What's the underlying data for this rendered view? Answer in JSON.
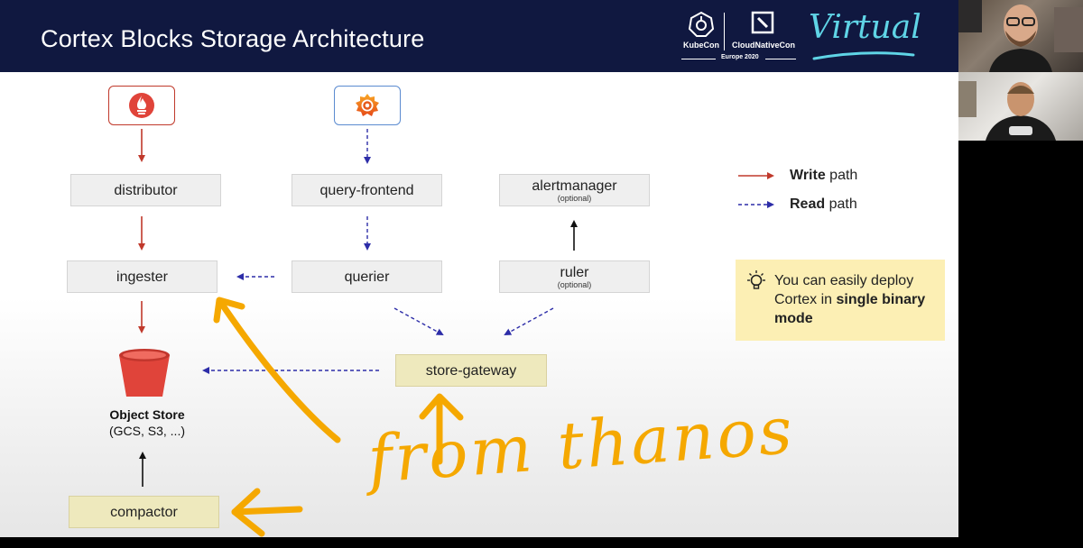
{
  "header": {
    "title": "Cortex Blocks Storage Architecture",
    "kubecon": "KubeCon",
    "cloudnativecon": "CloudNativeCon",
    "edition": "Europe 2020",
    "virtual": "Virtual"
  },
  "nodes": {
    "distributor": {
      "label": "distributor"
    },
    "query_frontend": {
      "label": "query-frontend"
    },
    "alertmanager": {
      "label": "alertmanager",
      "sub": "(optional)"
    },
    "ingester": {
      "label": "ingester"
    },
    "querier": {
      "label": "querier"
    },
    "ruler": {
      "label": "ruler",
      "sub": "(optional)"
    },
    "store_gateway": {
      "label": "store-gateway"
    },
    "compactor": {
      "label": "compactor"
    }
  },
  "object_store": {
    "title": "Object Store",
    "sub": "(GCS, S3, ...)"
  },
  "legend": {
    "write_bold": "Write",
    "write_rest": " path",
    "read_bold": "Read",
    "read_rest": " path"
  },
  "tip": {
    "text_before": "You can easily deploy Cortex in ",
    "text_bold": "single binary mode"
  },
  "annotation": {
    "text": "from thanos"
  },
  "colors": {
    "header_bg": "#101840",
    "write_path": "#c0392b",
    "read_path": "#2d2da8",
    "annotation": "#f5a800",
    "tip_bg": "#fcefb4",
    "tan_node": "#eee9bd",
    "grey_node": "#efefef"
  },
  "icons": [
    "prometheus-icon",
    "grafana-icon",
    "bucket-icon",
    "lightbulb-icon",
    "kubecon-logo",
    "cncf-logo"
  ]
}
